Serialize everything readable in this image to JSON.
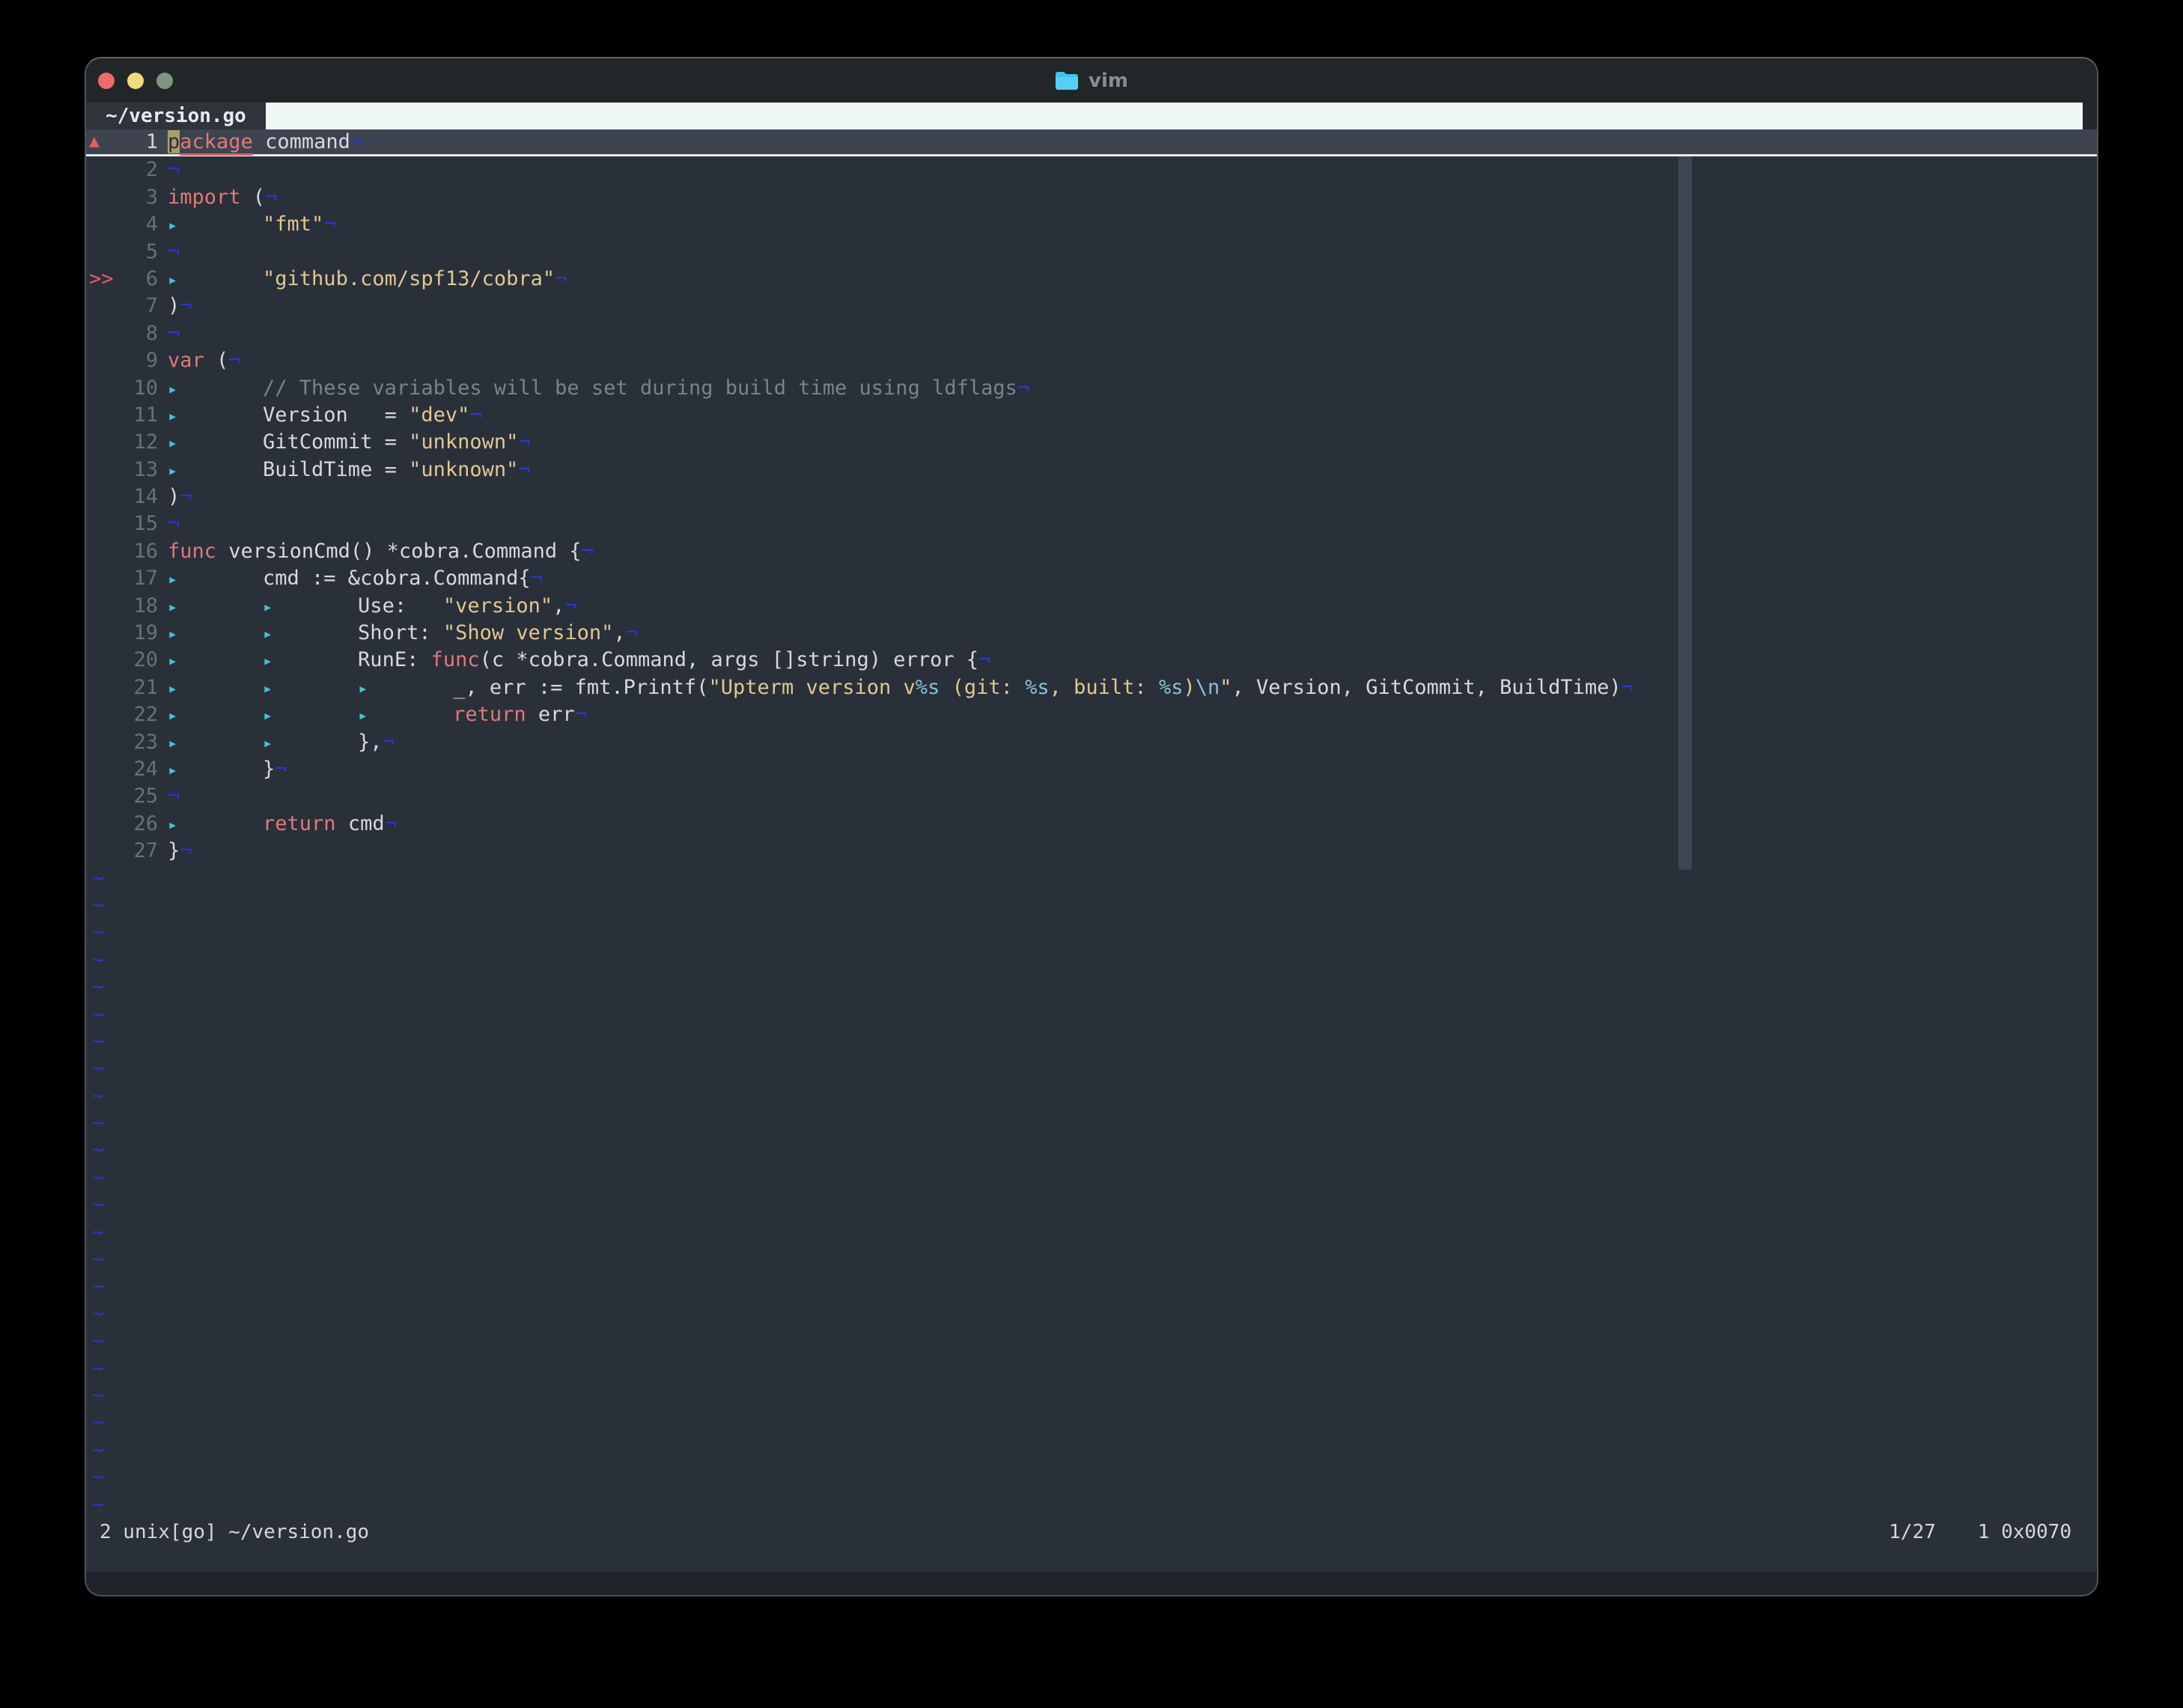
{
  "window": {
    "title": "vim",
    "title_icon": "folder-icon"
  },
  "traffic_lights": [
    "close",
    "minimize",
    "zoom"
  ],
  "tab": {
    "label": "~/version.go"
  },
  "editor": {
    "tab_marker": "▸",
    "eol_marker": "¬",
    "empty_marker": "~",
    "empty_count": 24,
    "signs": {
      "warning": "▲",
      "chevrons": ">>"
    },
    "lines": [
      {
        "n": 1,
        "sign": "warning",
        "cursorline": true,
        "segs": [
          {
            "s": "cursor",
            "t": "p"
          },
          {
            "s": "err",
            "t": "ackage"
          },
          {
            "s": "txt",
            "t": " command"
          },
          {
            "s": "eol"
          }
        ]
      },
      {
        "n": 2,
        "segs": [
          {
            "s": "eol"
          }
        ]
      },
      {
        "n": 3,
        "segs": [
          {
            "s": "kw",
            "t": "import"
          },
          {
            "s": "txt",
            "t": " ("
          },
          {
            "s": "eol"
          }
        ]
      },
      {
        "n": 4,
        "segs": [
          {
            "s": "tab"
          },
          {
            "s": "txt",
            "t": "       "
          },
          {
            "s": "str",
            "t": "\"fmt\""
          },
          {
            "s": "eol"
          }
        ]
      },
      {
        "n": 5,
        "segs": [
          {
            "s": "eol"
          }
        ]
      },
      {
        "n": 6,
        "sign": "chevrons",
        "segs": [
          {
            "s": "tab"
          },
          {
            "s": "txt",
            "t": "       "
          },
          {
            "s": "str",
            "t": "\"github.com/spf13/cobra\""
          },
          {
            "s": "eol"
          }
        ]
      },
      {
        "n": 7,
        "segs": [
          {
            "s": "txt",
            "t": ")"
          },
          {
            "s": "eol"
          }
        ]
      },
      {
        "n": 8,
        "segs": [
          {
            "s": "eol"
          }
        ]
      },
      {
        "n": 9,
        "segs": [
          {
            "s": "kw",
            "t": "var"
          },
          {
            "s": "txt",
            "t": " ("
          },
          {
            "s": "eol"
          }
        ]
      },
      {
        "n": 10,
        "segs": [
          {
            "s": "tab"
          },
          {
            "s": "txt",
            "t": "       "
          },
          {
            "s": "com",
            "t": "// These variables will be set during build time using ldflags"
          },
          {
            "s": "eol"
          }
        ]
      },
      {
        "n": 11,
        "segs": [
          {
            "s": "tab"
          },
          {
            "s": "txt",
            "t": "       Version   = "
          },
          {
            "s": "str",
            "t": "\"dev\""
          },
          {
            "s": "eol"
          }
        ]
      },
      {
        "n": 12,
        "segs": [
          {
            "s": "tab"
          },
          {
            "s": "txt",
            "t": "       GitCommit = "
          },
          {
            "s": "str",
            "t": "\"unknown\""
          },
          {
            "s": "eol"
          }
        ]
      },
      {
        "n": 13,
        "segs": [
          {
            "s": "tab"
          },
          {
            "s": "txt",
            "t": "       BuildTime = "
          },
          {
            "s": "str",
            "t": "\"unknown\""
          },
          {
            "s": "eol"
          }
        ]
      },
      {
        "n": 14,
        "segs": [
          {
            "s": "txt",
            "t": ")"
          },
          {
            "s": "eol"
          }
        ]
      },
      {
        "n": 15,
        "segs": [
          {
            "s": "eol"
          }
        ]
      },
      {
        "n": 16,
        "segs": [
          {
            "s": "kw",
            "t": "func"
          },
          {
            "s": "txt",
            "t": " versionCmd() *cobra.Command {"
          },
          {
            "s": "eol"
          }
        ]
      },
      {
        "n": 17,
        "segs": [
          {
            "s": "tab"
          },
          {
            "s": "txt",
            "t": "       cmd := &cobra.Command{"
          },
          {
            "s": "eol"
          }
        ]
      },
      {
        "n": 18,
        "segs": [
          {
            "s": "tab"
          },
          {
            "s": "txt",
            "t": "       "
          },
          {
            "s": "tab"
          },
          {
            "s": "txt",
            "t": "       Use:   "
          },
          {
            "s": "str",
            "t": "\"version\""
          },
          {
            "s": "txt",
            "t": ","
          },
          {
            "s": "eol"
          }
        ]
      },
      {
        "n": 19,
        "segs": [
          {
            "s": "tab"
          },
          {
            "s": "txt",
            "t": "       "
          },
          {
            "s": "tab"
          },
          {
            "s": "txt",
            "t": "       Short: "
          },
          {
            "s": "str",
            "t": "\"Show version\""
          },
          {
            "s": "txt",
            "t": ","
          },
          {
            "s": "eol"
          }
        ]
      },
      {
        "n": 20,
        "segs": [
          {
            "s": "tab"
          },
          {
            "s": "txt",
            "t": "       "
          },
          {
            "s": "tab"
          },
          {
            "s": "txt",
            "t": "       RunE: "
          },
          {
            "s": "kw",
            "t": "func"
          },
          {
            "s": "txt",
            "t": "(c *cobra.Command, args []string) error {"
          },
          {
            "s": "eol"
          }
        ]
      },
      {
        "n": 21,
        "segs": [
          {
            "s": "tab"
          },
          {
            "s": "txt",
            "t": "       "
          },
          {
            "s": "tab"
          },
          {
            "s": "txt",
            "t": "       "
          },
          {
            "s": "tab"
          },
          {
            "s": "txt",
            "t": "       _, err := fmt.Printf("
          },
          {
            "s": "str",
            "t": "\"Upterm version v"
          },
          {
            "s": "spec",
            "t": "%s"
          },
          {
            "s": "str",
            "t": " (git: "
          },
          {
            "s": "spec",
            "t": "%s"
          },
          {
            "s": "str",
            "t": ", built: "
          },
          {
            "s": "spec",
            "t": "%s"
          },
          {
            "s": "str",
            "t": ")"
          },
          {
            "s": "spec",
            "t": "\\n"
          },
          {
            "s": "str",
            "t": "\""
          },
          {
            "s": "txt",
            "t": ", Version, GitCommit, BuildTime)"
          },
          {
            "s": "eol"
          }
        ]
      },
      {
        "n": 22,
        "segs": [
          {
            "s": "tab"
          },
          {
            "s": "txt",
            "t": "       "
          },
          {
            "s": "tab"
          },
          {
            "s": "txt",
            "t": "       "
          },
          {
            "s": "tab"
          },
          {
            "s": "txt",
            "t": "       "
          },
          {
            "s": "kw",
            "t": "return"
          },
          {
            "s": "txt",
            "t": " err"
          },
          {
            "s": "eol"
          }
        ]
      },
      {
        "n": 23,
        "segs": [
          {
            "s": "tab"
          },
          {
            "s": "txt",
            "t": "       "
          },
          {
            "s": "tab"
          },
          {
            "s": "txt",
            "t": "       },"
          },
          {
            "s": "eol"
          }
        ]
      },
      {
        "n": 24,
        "segs": [
          {
            "s": "tab"
          },
          {
            "s": "txt",
            "t": "       }"
          },
          {
            "s": "eol"
          }
        ]
      },
      {
        "n": 25,
        "segs": [
          {
            "s": "eol"
          }
        ]
      },
      {
        "n": 26,
        "segs": [
          {
            "s": "tab"
          },
          {
            "s": "txt",
            "t": "       "
          },
          {
            "s": "kw",
            "t": "return"
          },
          {
            "s": "txt",
            "t": " cmd"
          },
          {
            "s": "eol"
          }
        ]
      },
      {
        "n": 27,
        "segs": [
          {
            "s": "txt",
            "t": "}"
          },
          {
            "s": "eol"
          }
        ]
      }
    ]
  },
  "status_bar": {
    "left": "2 unix[go] ~/version.go",
    "position": "1/27",
    "char_info": "1 0x0070"
  },
  "palette": {
    "editor_bg": "#293039",
    "titlebar_bg": "#232629",
    "tabline_fill": "#eef9f3",
    "tab_active_bg": "#2f343b",
    "cursorline_bg": "#3d4450",
    "cursorline_underline": "#e8ebee",
    "keyword": "#e27878",
    "string": "#e2c792",
    "special": "#89c0d8",
    "comment": "#7b828c",
    "text": "#d6d9de",
    "line_number": "#697078",
    "line_number_active": "#cfd3da",
    "tab_marker": "#43c3da",
    "eol_marker": "#2a35d4",
    "sign_red": "#e25f5f",
    "cursor_bg": "#aa9d6e",
    "traffic_red": "#ec6a6a",
    "traffic_yellow": "#f0db7d",
    "traffic_green": "#7d967f",
    "scrollbar": "#3e4553",
    "folder_icon": "#3cc5ee"
  }
}
